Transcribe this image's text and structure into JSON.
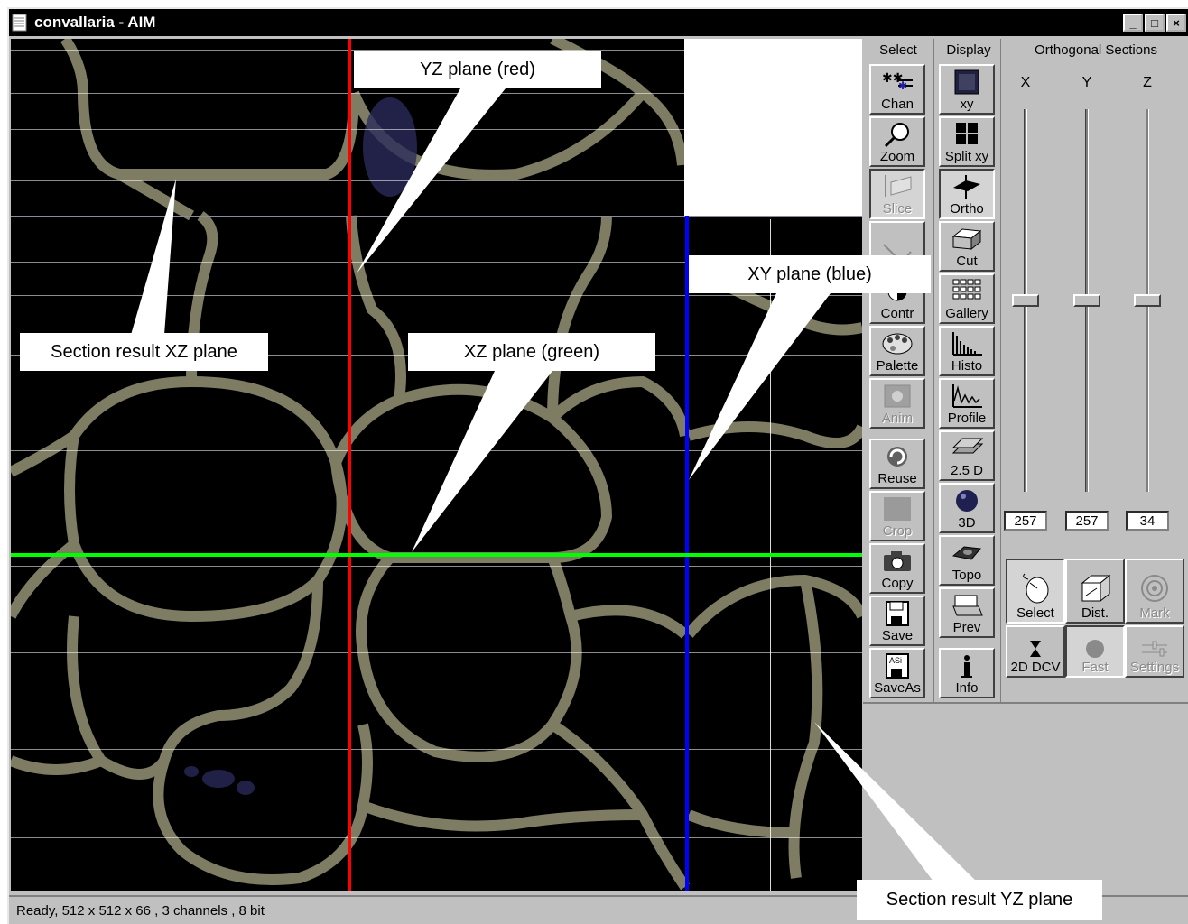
{
  "window": {
    "title": "convallaria - AIM",
    "minimize": "_",
    "maximize": "□",
    "close": "×"
  },
  "callouts": {
    "yz_plane": "YZ plane (red)",
    "xy_plane": "XY plane (blue)",
    "xz_plane": "XZ plane (green)",
    "section_xz": "Section result XZ plane",
    "section_yz": "Section result YZ plane"
  },
  "panel": {
    "select_header": "Select",
    "display_header": "Display",
    "ortho_header": "Orthogonal Sections",
    "select_tools": [
      {
        "label": "Chan",
        "icon": "channel-icon"
      },
      {
        "label": "Zoom",
        "icon": "magnifier-icon"
      },
      {
        "label": "Slice",
        "icon": "slice-icon"
      },
      {
        "label": "",
        "icon": "line-tool-icon"
      },
      {
        "label": "Contr",
        "icon": "contrast-icon"
      },
      {
        "label": "Palette",
        "icon": "palette-icon"
      },
      {
        "label": "Anim",
        "icon": "animation-icon"
      },
      {
        "label": "Reuse",
        "icon": "reuse-icon"
      },
      {
        "label": "Crop",
        "icon": "crop-icon"
      },
      {
        "label": "Copy",
        "icon": "camera-icon"
      },
      {
        "label": "Save",
        "icon": "floppy-icon"
      },
      {
        "label": "SaveAs",
        "icon": "floppy-ascii-icon"
      }
    ],
    "display_tools": [
      {
        "label": "xy",
        "icon": "xy-view-icon"
      },
      {
        "label": "Split xy",
        "icon": "split-icon"
      },
      {
        "label": "Ortho",
        "icon": "ortho-icon"
      },
      {
        "label": "Cut",
        "icon": "cut-icon"
      },
      {
        "label": "Gallery",
        "icon": "gallery-icon"
      },
      {
        "label": "Histo",
        "icon": "histogram-icon"
      },
      {
        "label": "Profile",
        "icon": "profile-icon"
      },
      {
        "label": "2.5 D",
        "icon": "2-5d-icon"
      },
      {
        "label": "3D",
        "icon": "sphere-icon"
      },
      {
        "label": "Topo",
        "icon": "topo-icon"
      },
      {
        "label": "Prev",
        "icon": "printer-icon"
      },
      {
        "label": "Info",
        "icon": "info-icon"
      }
    ],
    "axes": [
      {
        "name": "X",
        "value": "257",
        "level": 0.5
      },
      {
        "name": "Y",
        "value": "257",
        "level": 0.5
      },
      {
        "name": "Z",
        "value": "34",
        "level": 0.5
      }
    ],
    "ortho_buttons": [
      {
        "label": "Select",
        "icon": "mouse-icon"
      },
      {
        "label": "Dist.",
        "icon": "distance-cube-icon"
      },
      {
        "label": "Mark",
        "icon": "target-icon"
      },
      {
        "label": "2D DCV",
        "icon": "hourglass-icon"
      },
      {
        "label": "Fast",
        "icon": "circle-icon"
      },
      {
        "label": "Settings",
        "icon": "sliders-icon"
      }
    ]
  },
  "status": {
    "text": "Ready, 512 x 512 x 66 , 3 channels , 8 bit"
  },
  "colors": {
    "yz_line": "#ff0000",
    "xy_line": "#0000ff",
    "xz_line": "#00ff00",
    "cell_wall": "#8c8a6e"
  }
}
